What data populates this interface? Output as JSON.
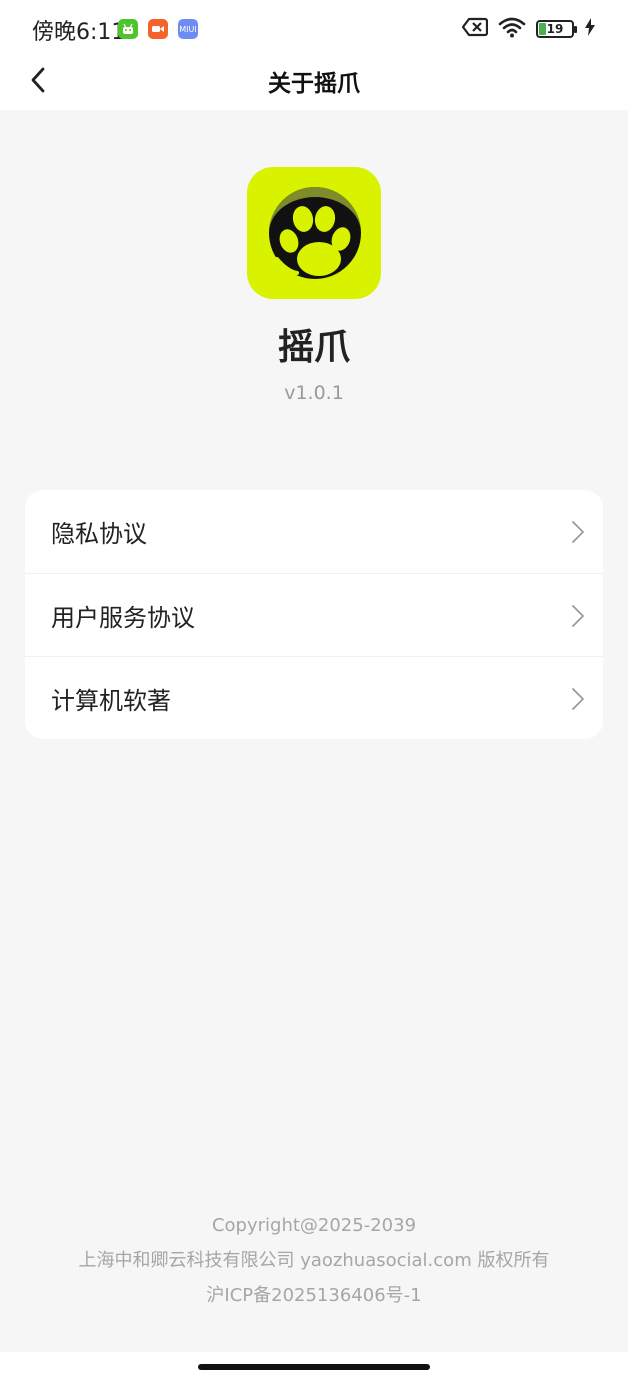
{
  "status_bar": {
    "time": "傍晚6:11",
    "battery": "19",
    "badges": [
      {
        "name": "android-app-icon",
        "color": "#4fc42d"
      },
      {
        "name": "video-app-icon",
        "color": "#f4632c"
      },
      {
        "name": "miui-app-icon",
        "color": "#6e8cf3",
        "text": "MIUI"
      }
    ]
  },
  "nav": {
    "title": "关于摇爪"
  },
  "app": {
    "name": "摇爪",
    "version": "v1.0.1",
    "icon": "paw-logo-icon",
    "brand_color": "#d9f200"
  },
  "menu": {
    "items": [
      {
        "label": "隐私协议"
      },
      {
        "label": "用户服务协议"
      },
      {
        "label": "计算机软著"
      }
    ]
  },
  "footer": {
    "copyright": "Copyright@2025-2039",
    "company": "上海中和卿云科技有限公司 yaozhuasocial.com 版权所有",
    "icp": "沪ICP备2025136406号-1"
  }
}
